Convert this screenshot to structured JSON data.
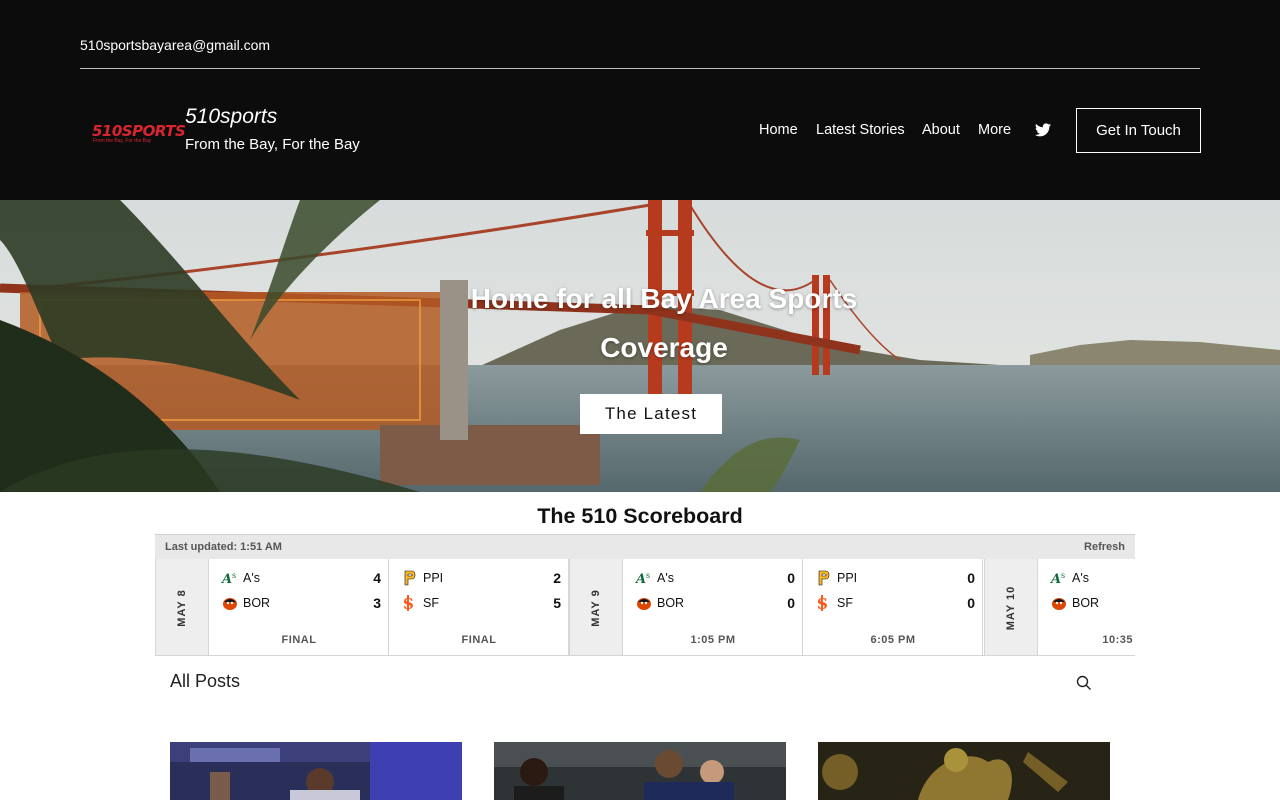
{
  "header": {
    "email": "510sportsbayarea@gmail.com",
    "logo_main": "510SPORTS",
    "logo_sub": "From the Bay, For the Bay",
    "site_title": "510sports",
    "tagline": "From the Bay, For the Bay",
    "nav": [
      {
        "label": "Home"
      },
      {
        "label": "Latest Stories"
      },
      {
        "label": "About"
      },
      {
        "label": "More"
      }
    ],
    "social_icon": "twitter-icon",
    "cta_label": "Get In Touch"
  },
  "hero": {
    "title": "Home for all Bay Area Sports Coverage",
    "button_label": "The Latest"
  },
  "scoreboard": {
    "title": "The 510 Scoreboard",
    "last_updated": "Last updated: 1:51 AM",
    "refresh_label": "Refresh",
    "dates": [
      "MAY 8",
      "MAY 9",
      "MAY 10"
    ],
    "games": [
      {
        "teams": [
          {
            "name": "A's",
            "score": "4",
            "logo": "athletics-logo"
          },
          {
            "name": "BOR",
            "score": "3",
            "logo": "orioles-logo"
          }
        ],
        "status": "FINAL"
      },
      {
        "teams": [
          {
            "name": "PPI",
            "score": "2",
            "logo": "pirates-logo"
          },
          {
            "name": "SF",
            "score": "5",
            "logo": "giants-logo"
          }
        ],
        "status": "FINAL"
      },
      {
        "teams": [
          {
            "name": "A's",
            "score": "0",
            "logo": "athletics-logo"
          },
          {
            "name": "BOR",
            "score": "0",
            "logo": "orioles-logo"
          }
        ],
        "status": "1:05 PM"
      },
      {
        "teams": [
          {
            "name": "PPI",
            "score": "0",
            "logo": "pirates-logo"
          },
          {
            "name": "SF",
            "score": "0",
            "logo": "giants-logo"
          }
        ],
        "status": "6:05 PM"
      },
      {
        "teams": [
          {
            "name": "A's",
            "score": "",
            "logo": "athletics-logo"
          },
          {
            "name": "BOR",
            "score": "",
            "logo": "orioles-logo"
          }
        ],
        "status": "10:35"
      }
    ],
    "colors": {
      "athletics": "#0f6b3a",
      "athletics_accent": "#efb21e",
      "orioles": "#df4601",
      "pirates": "#fdb827",
      "giants": "#fd5a1e"
    }
  },
  "posts": {
    "title": "All Posts",
    "search_icon": "search-icon"
  }
}
